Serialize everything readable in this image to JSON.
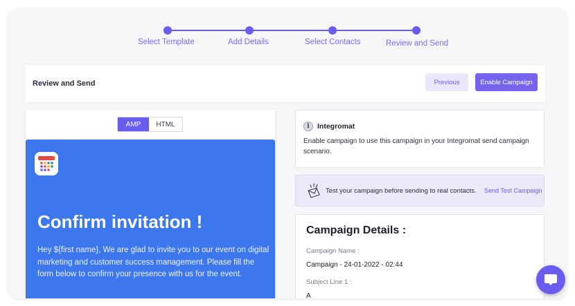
{
  "stepper": {
    "steps": [
      {
        "label": "Select Template"
      },
      {
        "label": "Add Details"
      },
      {
        "label": "Select Contacts"
      },
      {
        "label": "Review and Send"
      }
    ]
  },
  "header": {
    "title": "Review and Send",
    "previous_label": "Previous",
    "enable_label": "Enable Campaign"
  },
  "preview": {
    "tabs": [
      "AMP",
      "HTML"
    ],
    "active_tab": "AMP",
    "icon": "calendar-icon",
    "heading": "Confirm invitation !",
    "body": "Hey ${first name}, We are glad to invite you to our event on digital marketing and customer success management. Please fill the form below to confirm your presence with us for the event."
  },
  "integromat": {
    "icon": "info-icon",
    "title": "Integromat",
    "text": "Enable campaign to use this campaign in your Integromat send campaign scenario."
  },
  "test_bar": {
    "icon": "envelope-icon",
    "text": "Test your campaign before sending to real contacts.",
    "link_label": "Send Test Campaign"
  },
  "details": {
    "title": "Campaign Details :",
    "campaign_name_label": "Campaign Name :",
    "campaign_name_value": "Campaign - 24-01-2022 - 02:44",
    "subject_label": "Subject Line 1 :",
    "subject_value": "A"
  },
  "chat": {
    "icon": "chat-icon"
  },
  "colors": {
    "accent": "#6b5cf0",
    "email_background": "#3c77ee",
    "page_background": "#f6f6f9"
  }
}
